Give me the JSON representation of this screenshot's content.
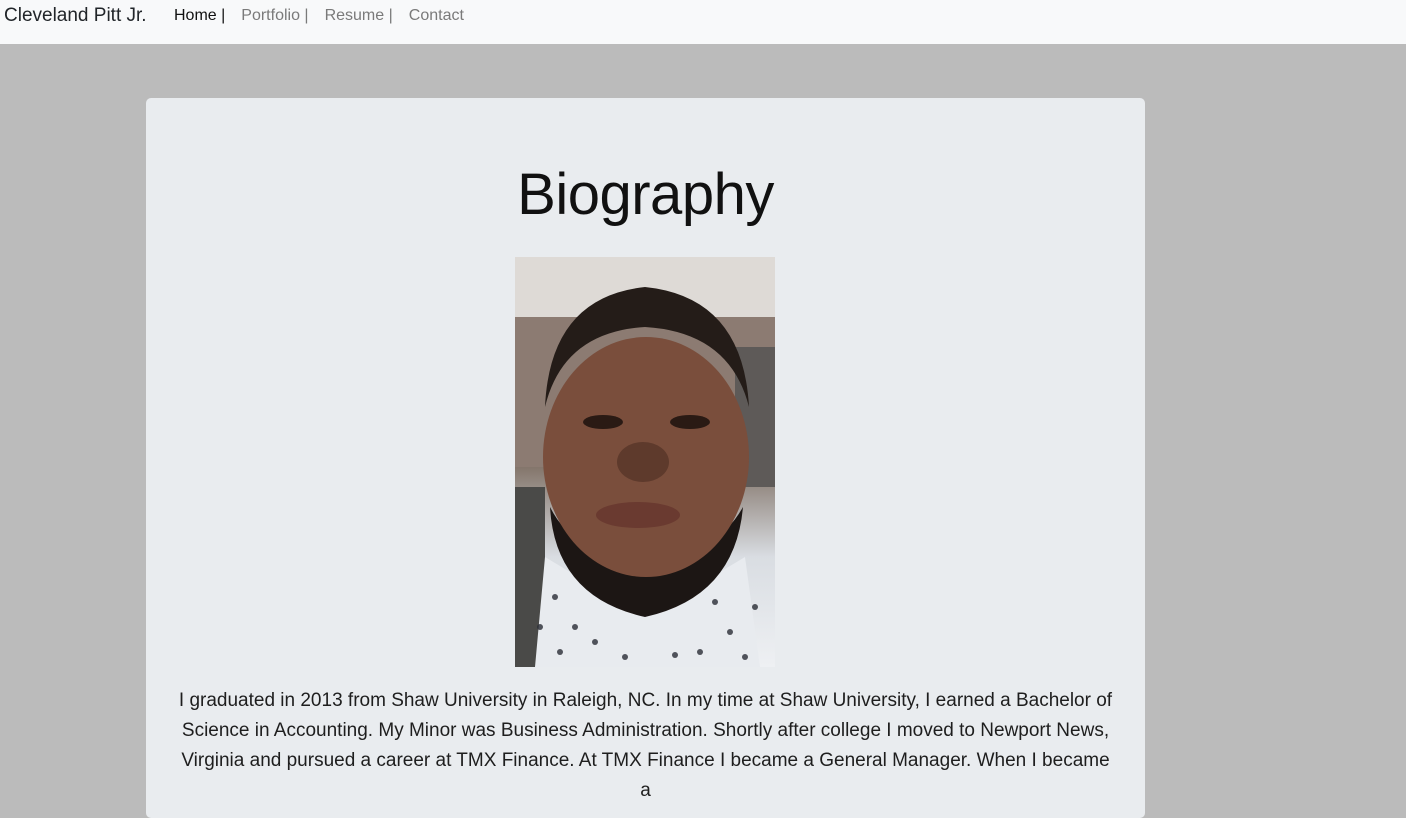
{
  "navbar": {
    "brand": "Cleveland Pitt Jr.",
    "links": [
      {
        "label": "Home |",
        "active": true
      },
      {
        "label": "Portfolio |",
        "active": false
      },
      {
        "label": "Resume |",
        "active": false
      },
      {
        "label": "Contact",
        "active": false
      }
    ]
  },
  "main": {
    "title": "Biography",
    "bio_text": "I graduated in 2013 from Shaw University in Raleigh, NC. In my time at Shaw University, I earned a Bachelor of Science in Accounting. My Minor was Business Administration. Shortly after college I moved to Newport News, Virginia and pursued a career at TMX Finance. At TMX Finance I became a General Manager. When I became a"
  },
  "colors": {
    "page_background": "#bbbbbb",
    "navbar_background": "#f8f9fa",
    "card_background": "#e9ecef",
    "nav_active": "#111111",
    "nav_inactive": "#7a7a7a"
  }
}
